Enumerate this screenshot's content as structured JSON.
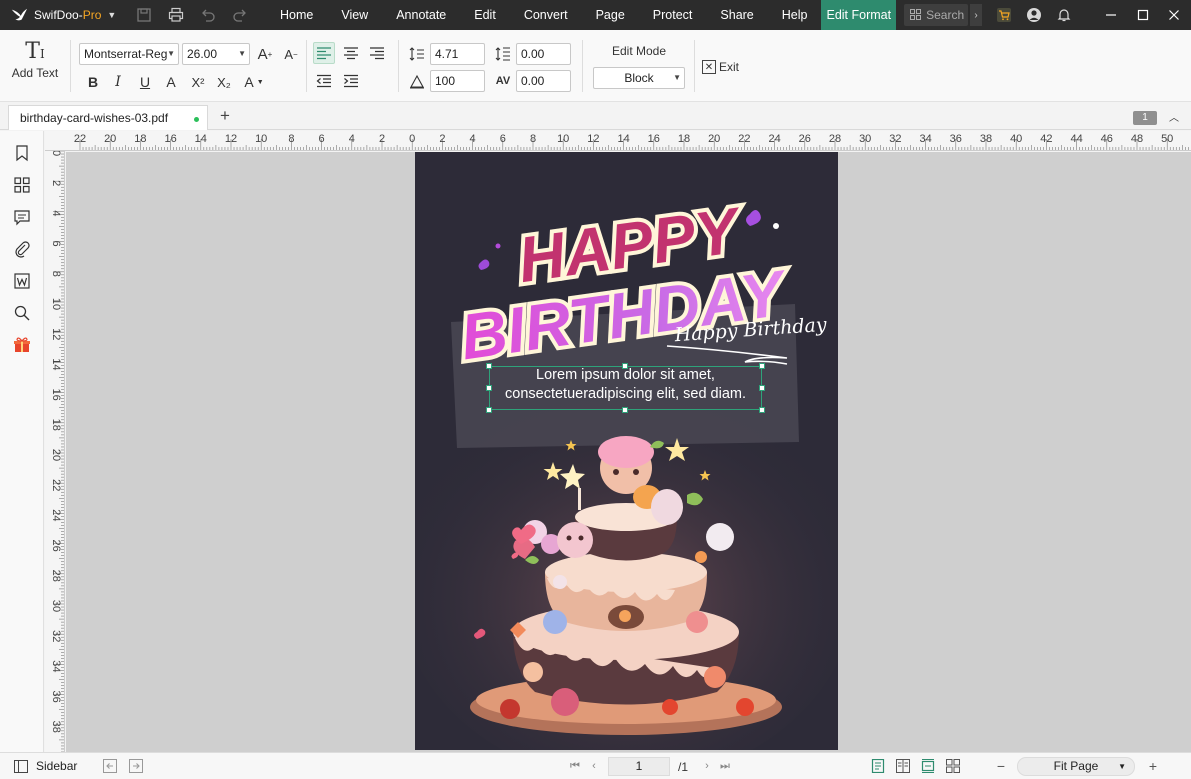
{
  "app": {
    "brand": "SwifDoo-",
    "edition": "Pro"
  },
  "menu": [
    "Home",
    "View",
    "Annotate",
    "Edit",
    "Convert",
    "Page",
    "Protect",
    "Share",
    "Help",
    "Edit Format"
  ],
  "search": {
    "placeholder": "Search"
  },
  "ribbon": {
    "add_text": "Add Text",
    "font_family": "Montserrat-Reg",
    "font_size": "26.00",
    "line_spacing": "4.71",
    "paragraph_spacing": "0.00",
    "scale": "100",
    "char_spacing": "0.00",
    "edit_mode_label": "Edit Mode",
    "edit_mode_value": "Block",
    "exit_label": "Exit",
    "bold": "B",
    "italic": "I",
    "underline": "U",
    "strike": "A",
    "superscript": "X²",
    "subscript": "X₂",
    "font_color": "A"
  },
  "tabs": {
    "document": "birthday-card-wishes-03.pdf",
    "page_badge": "1"
  },
  "ruler": {
    "top_labels": [
      "22",
      "20",
      "18",
      "16",
      "14",
      "12",
      "10",
      "8",
      "6",
      "4",
      "2",
      "0",
      "2",
      "4",
      "6",
      "8",
      "10",
      "12",
      "14",
      "16",
      "18",
      "20",
      "22",
      "24",
      "26",
      "28",
      "30",
      "32",
      "34",
      "36",
      "38",
      "40",
      "42",
      "44",
      "46",
      "48",
      "50"
    ],
    "left_labels": [
      "0",
      "2",
      "4",
      "6",
      "8",
      "10",
      "12",
      "14",
      "16",
      "18",
      "20",
      "22",
      "24",
      "26",
      "28",
      "30",
      "32",
      "34",
      "36",
      "38"
    ]
  },
  "card": {
    "title_line1": "HAPPY",
    "title_line2": "BIRTHDAY",
    "script_text": "Happy Birthday",
    "body_line1": "Lorem ipsum dolor sit amet,",
    "body_line2": "consectetueradipiscing elit, sed diam."
  },
  "status": {
    "sidebar_label": "Sidebar",
    "current_page": "1",
    "total_pages": "/1",
    "zoom": "Fit Page"
  },
  "colors": {
    "accent": "#2e8b6e",
    "titlebar": "#2c2c2c",
    "card_bg": "#2d2b38"
  }
}
